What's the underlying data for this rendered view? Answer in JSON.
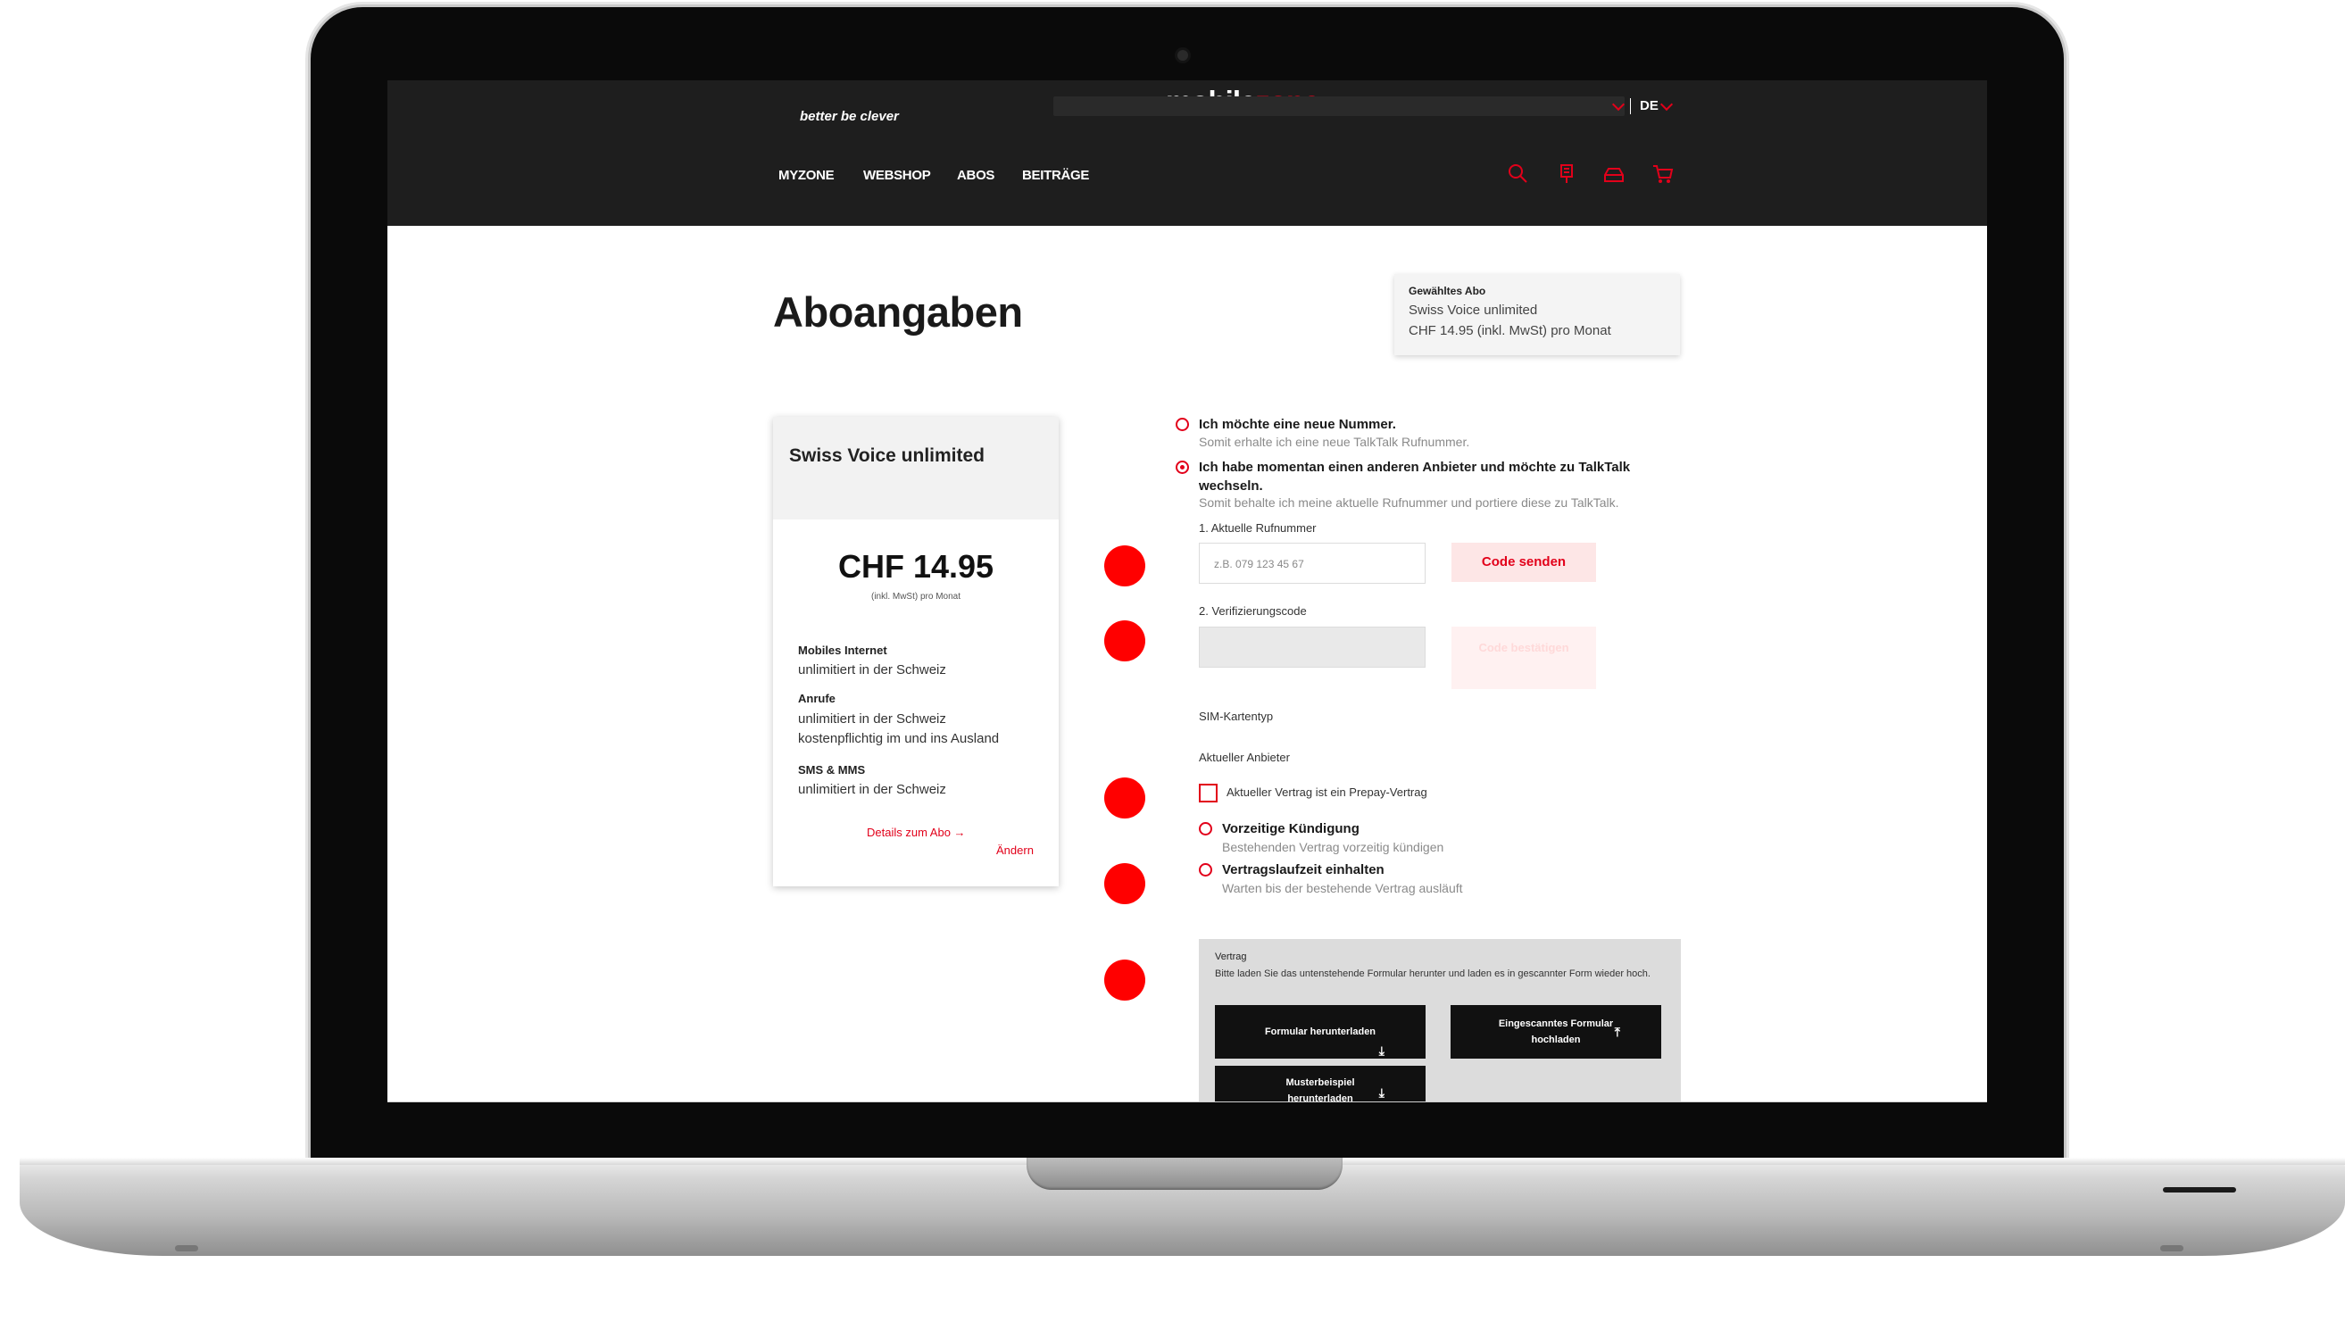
{
  "header": {
    "logo_main": "mobile",
    "logo_accent": "zone",
    "logo_tagline": "better be clever",
    "language": "DE",
    "nav": [
      "MYZONE",
      "WEBSHOP",
      "ABOS",
      "BEITRÄGE"
    ],
    "icons": [
      "search-icon",
      "store-location-icon",
      "account-icon",
      "cart-icon"
    ]
  },
  "page": {
    "title": "Aboangaben",
    "selected": {
      "label": "Gewähltes Abo",
      "name": "Swiss Voice unlimited",
      "price": "CHF 14.95 (inkl. MwSt) pro Monat"
    }
  },
  "card": {
    "title": "Swiss Voice unlimited",
    "price": "CHF 14.95",
    "price_note": "(inkl. MwSt) pro Monat",
    "features": [
      {
        "label": "Mobiles Internet",
        "value": "unlimitiert in der Schweiz"
      },
      {
        "label": "Anrufe",
        "value": "unlimitiert in der Schweiz",
        "value2": "kostenpflichtig im und ins Ausland"
      },
      {
        "label": "SMS & MMS",
        "value": "unlimitiert in der Schweiz"
      }
    ],
    "details_link": "Details zum Abo →",
    "edit_link": "Ändern"
  },
  "form": {
    "option_new": {
      "label": "Ich möchte eine neue Nummer.",
      "sub": "Somit erhalte ich eine neue TalkTalk Rufnummer."
    },
    "option_port": {
      "label1": "Ich habe momentan einen anderen Anbieter und möchte zu TalkTalk",
      "label2": "wechseln.",
      "sub": "Somit behalte ich meine aktuelle Rufnummer und portiere diese zu TalkTalk."
    },
    "current_number_label": "1. Aktuelle Rufnummer",
    "current_number_placeholder": "z.B. 079 123 45 67",
    "send_code_button": "Code senden",
    "verification_label": "2. Verifizierungscode",
    "confirm_code_button": "Code bestätigen",
    "sim_type_label": "SIM-Kartentyp",
    "provider_label": "Aktueller Anbieter",
    "prepay_checkbox": "Aktueller Vertrag ist ein Prepay-Vertrag",
    "early_termination": {
      "label": "Vorzeitige Kündigung",
      "sub": "Bestehenden Vertrag vorzeitig kündigen"
    },
    "keep_term": {
      "label": "Vertragslaufzeit einhalten",
      "sub": "Warten bis der bestehende Vertrag ausläuft"
    },
    "contract": {
      "title": "Vertrag",
      "text": "Bitte laden Sie das untenstehende Formular herunter und laden es in gescannter Form wieder hoch.",
      "download_button": "Formular herunterladen",
      "upload_button": "Eingescanntes Formular hochladen",
      "sample_button": "Musterbeispiel herunterladen"
    }
  },
  "colors": {
    "accent": "#e2001a",
    "header_bg": "#1e1e1e",
    "annotation_dot": "#ff0000"
  }
}
